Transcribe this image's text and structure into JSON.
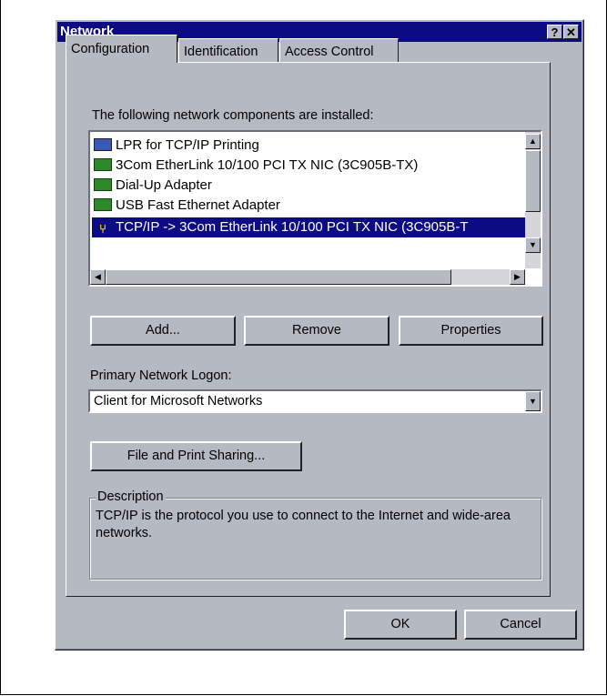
{
  "window": {
    "title": "Network",
    "help_glyph": "?",
    "close_glyph": "✕"
  },
  "tabs": [
    {
      "label": "Configuration",
      "active": true
    },
    {
      "label": "Identification",
      "active": false
    },
    {
      "label": "Access Control",
      "active": false
    }
  ],
  "components": {
    "label": "The following network components are installed:",
    "items": [
      {
        "icon": "printer-icon",
        "text": "LPR for TCP/IP Printing"
      },
      {
        "icon": "network-card-icon",
        "text": "3Com EtherLink 10/100 PCI TX NIC (3C905B-TX)"
      },
      {
        "icon": "network-card-icon",
        "text": "Dial-Up Adapter"
      },
      {
        "icon": "network-card-icon",
        "text": "USB Fast Ethernet Adapter"
      },
      {
        "icon": "protocol-icon",
        "text": "TCP/IP -> 3Com EtherLink 10/100 PCI TX NIC (3C905B-T",
        "selected": true
      }
    ]
  },
  "buttons": {
    "add": "Add...",
    "remove": "Remove",
    "properties": "Properties",
    "file_print": "File and Print Sharing...",
    "ok": "OK",
    "cancel": "Cancel"
  },
  "logon": {
    "label": "Primary Network Logon:",
    "value": "Client for Microsoft Networks"
  },
  "description": {
    "legend": "Description",
    "text": "TCP/IP is the protocol you use to connect to the Internet and wide-area networks."
  },
  "colors": {
    "titlebar": "#0d0b84",
    "face": "#b5b9c2",
    "selection": "#0d0b84"
  }
}
